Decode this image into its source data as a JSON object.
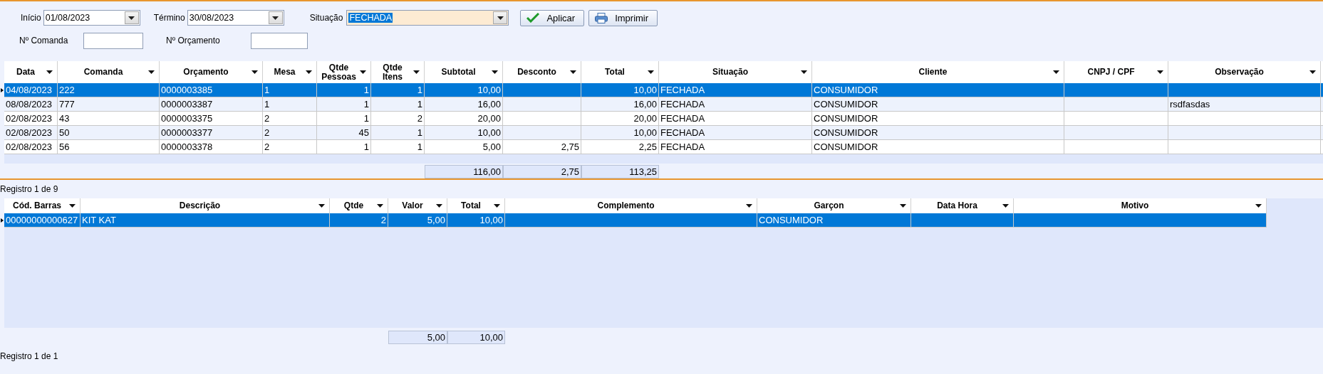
{
  "filters": {
    "start": {
      "label": "Início",
      "value": "01/08/2023"
    },
    "end": {
      "label": "Término",
      "value": "30/08/2023"
    },
    "status": {
      "label": "Situação",
      "value": "FECHADA",
      "focused": true
    },
    "order_number": {
      "label": "Nº Comanda"
    },
    "quote_number": {
      "label": "Nº Orçamento"
    }
  },
  "buttons": [
    {
      "label": "Aplicar",
      "kind": "apply"
    },
    {
      "label": "Imprimir",
      "kind": "print"
    }
  ],
  "orders": {
    "columns": [
      {
        "label": "Data"
      },
      {
        "label": "Comanda"
      },
      {
        "label": "Orçamento"
      },
      {
        "label": "Mesa"
      },
      {
        "label": "Qtde\nPessoas"
      },
      {
        "label": "Qtde\nItens"
      },
      {
        "label": "Subtotal",
        "total": "116,00"
      },
      {
        "label": "Desconto",
        "total": "2,75"
      },
      {
        "label": "Total",
        "total": "113,25"
      },
      {
        "label": "Situação"
      },
      {
        "label": "Cliente"
      },
      {
        "label": "CNPJ / CPF"
      },
      {
        "label": "Observação"
      }
    ],
    "rows": [
      {
        "selected": true,
        "cells": [
          "04/08/2023",
          "222",
          "0000003385",
          "1",
          "1",
          "1",
          "10,00",
          null,
          "10,00",
          "FECHADA",
          "CONSUMIDOR",
          null,
          null
        ]
      },
      {
        "selected": false,
        "cells": [
          "08/08/2023",
          "777",
          "0000003387",
          "1",
          "1",
          "1",
          "16,00",
          null,
          "16,00",
          "FECHADA",
          "CONSUMIDOR",
          null,
          "rsdfasdas"
        ]
      },
      {
        "selected": false,
        "cells": [
          "02/08/2023",
          "43",
          "0000003375",
          "2",
          "1",
          "2",
          "20,00",
          null,
          "20,00",
          "FECHADA",
          "CONSUMIDOR",
          null,
          null
        ]
      },
      {
        "selected": false,
        "cells": [
          "02/08/2023",
          "50",
          "0000003377",
          "2",
          "45",
          "1",
          "10,00",
          null,
          "10,00",
          "FECHADA",
          "CONSUMIDOR",
          null,
          null
        ]
      },
      {
        "selected": false,
        "cells": [
          "02/08/2023",
          "56",
          "0000003378",
          "2",
          "1",
          "1",
          "5,00",
          "2,75",
          "2,25",
          "FECHADA",
          "CONSUMIDOR",
          null,
          null
        ]
      }
    ],
    "status": "Registro 1 de 9"
  },
  "items": {
    "columns": [
      {
        "label": "Cód. Barras"
      },
      {
        "label": "Descrição"
      },
      {
        "label": "Qtde"
      },
      {
        "label": "Valor",
        "total": "5,00"
      },
      {
        "label": "Total",
        "total": "10,00"
      },
      {
        "label": "Complemento"
      },
      {
        "label": "Garçon"
      },
      {
        "label": "Data Hora"
      },
      {
        "label": "Motivo"
      }
    ],
    "rows": [
      {
        "selected": true,
        "cells": [
          "00000000000627",
          "KIT KAT",
          "2",
          "5,00",
          "10,00",
          null,
          "CONSUMIDOR",
          null,
          null
        ]
      }
    ],
    "status": "Registro 1 de 1"
  }
}
